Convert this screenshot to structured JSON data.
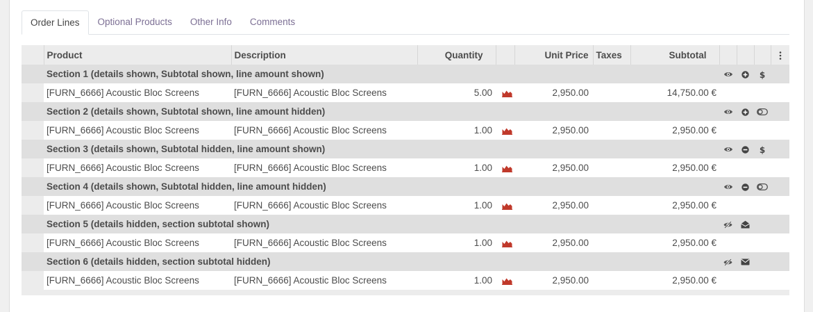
{
  "tabs": [
    "Order Lines",
    "Optional Products",
    "Other Info",
    "Comments"
  ],
  "columns": {
    "product": "Product",
    "description": "Description",
    "quantity": "Quantity",
    "unit_price": "Unit Price",
    "taxes": "Taxes",
    "subtotal": "Subtotal",
    "options_icon": "kebab-menu-icon"
  },
  "rows": [
    {
      "section": "Section 1 (details shown, Subtotal shown, line amount shown)",
      "icons": [
        "eye-icon",
        "plus-circle-icon",
        "dollar-icon"
      ],
      "line": {
        "product": "[FURN_6666] Acoustic Bloc Screens",
        "description": "[FURN_6666] Acoustic Bloc Screens",
        "quantity": "5.00",
        "unit_price": "2,950.00",
        "subtotal": "14,750.00 €"
      }
    },
    {
      "section": "Section 2 (details shown, Subtotal shown, line amount hidden)",
      "icons": [
        "eye-icon",
        "plus-circle-icon",
        "toggle-off-icon"
      ],
      "line": {
        "product": "[FURN_6666] Acoustic Bloc Screens",
        "description": "[FURN_6666] Acoustic Bloc Screens",
        "quantity": "1.00",
        "unit_price": "2,950.00",
        "subtotal": "2,950.00 €"
      }
    },
    {
      "section": "Section 3 (details shown, Subtotal hidden, line amount shown)",
      "icons": [
        "eye-icon",
        "minus-circle-icon",
        "dollar-icon"
      ],
      "line": {
        "product": "[FURN_6666] Acoustic Bloc Screens",
        "description": "[FURN_6666] Acoustic Bloc Screens",
        "quantity": "1.00",
        "unit_price": "2,950.00",
        "subtotal": "2,950.00 €"
      }
    },
    {
      "section": "Section 4 (details shown, Subtotal hidden, line amount hidden)",
      "icons": [
        "eye-icon",
        "minus-circle-icon",
        "toggle-off-icon"
      ],
      "line": {
        "product": "[FURN_6666] Acoustic Bloc Screens",
        "description": "[FURN_6666] Acoustic Bloc Screens",
        "quantity": "1.00",
        "unit_price": "2,950.00",
        "subtotal": "2,950.00 €"
      }
    },
    {
      "section": "Section 5 (details hidden, section subtotal shown)",
      "icons": [
        "eye-slash-icon",
        "envelope-open-icon"
      ],
      "line": {
        "product": "[FURN_6666] Acoustic Bloc Screens",
        "description": "[FURN_6666] Acoustic Bloc Screens",
        "quantity": "1.00",
        "unit_price": "2,950.00",
        "subtotal": "2,950.00 €"
      }
    },
    {
      "section": "Section 6 (details hidden, section subtotal hidden)",
      "icons": [
        "eye-slash-icon",
        "envelope-icon"
      ],
      "line": {
        "product": "[FURN_6666] Acoustic Bloc Screens",
        "description": "[FURN_6666] Acoustic Bloc Screens",
        "quantity": "1.00",
        "unit_price": "2,950.00",
        "subtotal": "2,950.00 €"
      }
    }
  ],
  "colors": {
    "tab_inactive": "#7c6f94",
    "forecast_icon": "#c0392b",
    "section_bg": "#dfdfdf",
    "header_bg": "#ececec"
  }
}
